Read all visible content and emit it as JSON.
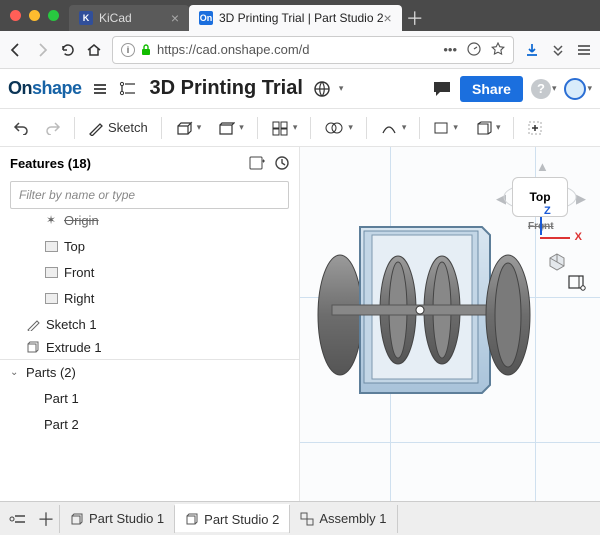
{
  "browser": {
    "tabs": [
      {
        "label": "KiCad"
      },
      {
        "label": "3D Printing Trial | Part Studio 2"
      }
    ],
    "url_display": "https://cad.onshape.com/d"
  },
  "app": {
    "logo_prefix": "On",
    "logo_suffix": "shape",
    "doc_title": "3D Printing Trial",
    "share_label": "Share"
  },
  "toolbar": {
    "sketch_label": "Sketch"
  },
  "features": {
    "header": "Features (18)",
    "filter_placeholder": "Filter by name or type",
    "items": {
      "origin": "Origin",
      "top": "Top",
      "front": "Front",
      "right": "Right",
      "sketch1": "Sketch 1",
      "extrude1": "Extrude 1"
    },
    "parts_header": "Parts (2)",
    "parts": [
      "Part 1",
      "Part 2"
    ]
  },
  "viewcube": {
    "label": "Top",
    "z": "Z",
    "x": "X",
    "front": "Front"
  },
  "bottom_tabs": {
    "ps1": "Part Studio 1",
    "ps2": "Part Studio 2",
    "asm": "Assembly 1"
  }
}
